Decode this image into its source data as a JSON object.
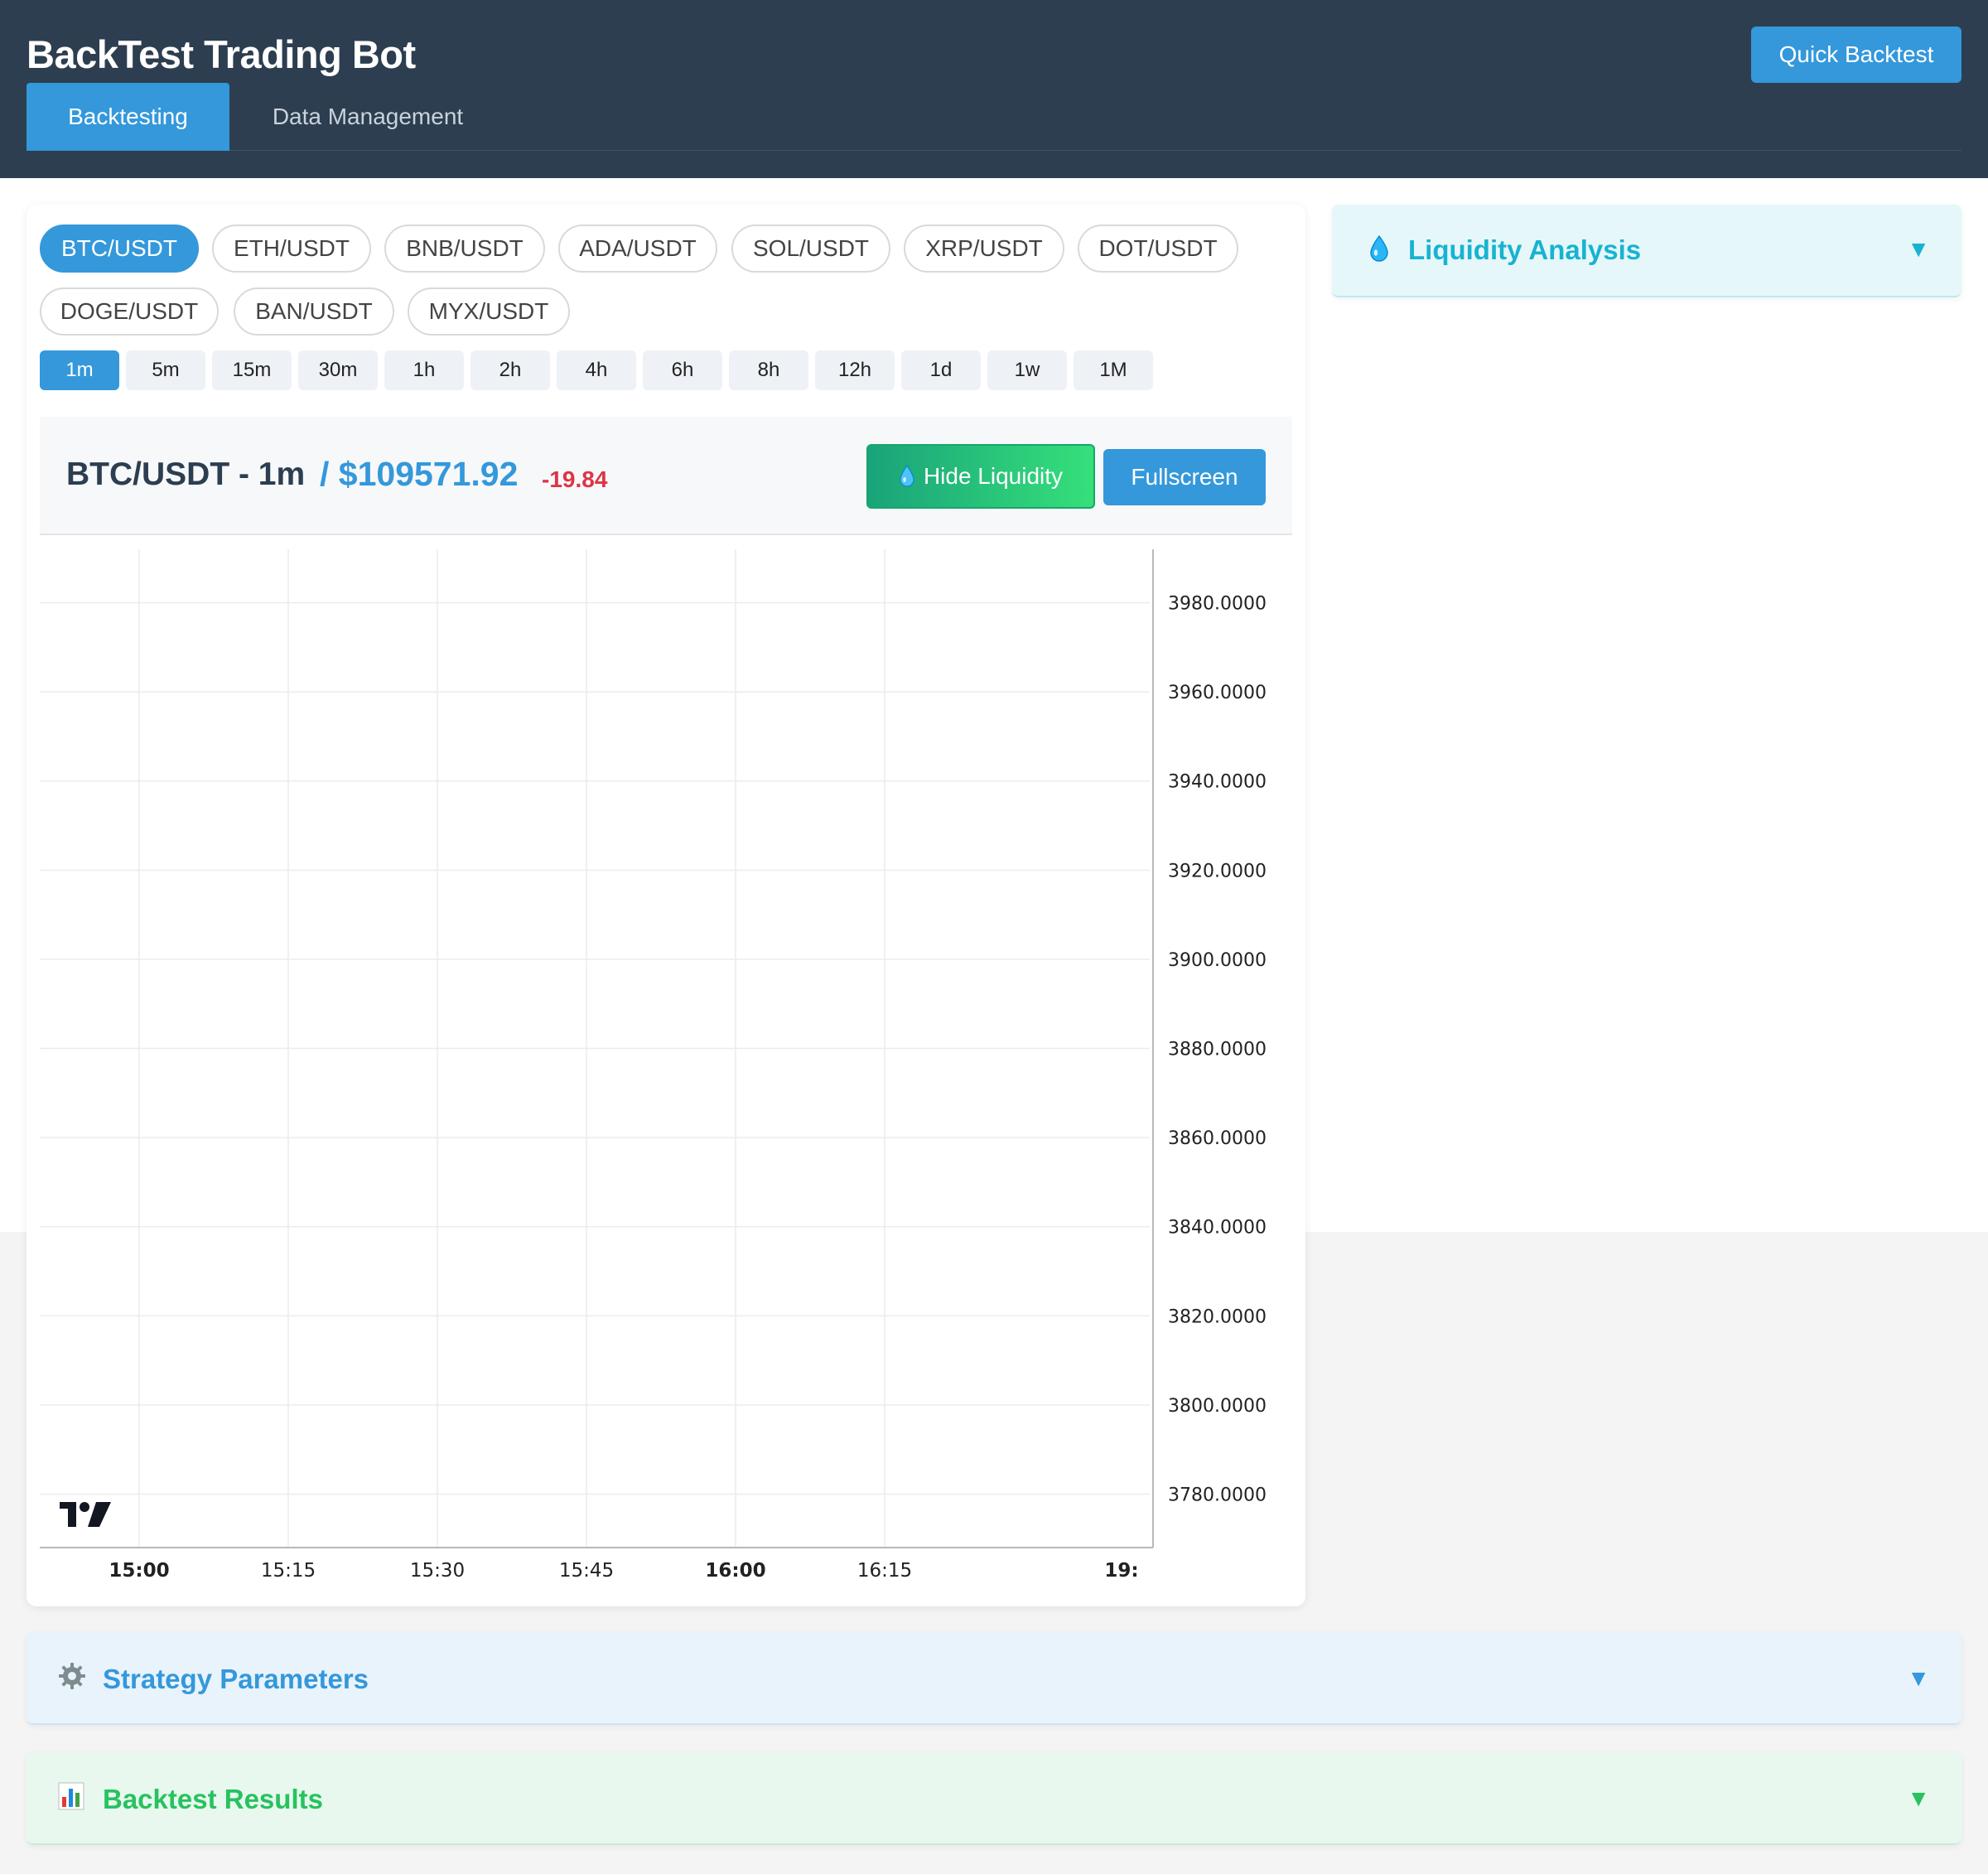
{
  "app": {
    "title": "BackTest Trading Bot",
    "quick_backtest_label": "Quick Backtest"
  },
  "nav": {
    "tabs": [
      {
        "label": "Backtesting",
        "active": true
      },
      {
        "label": "Data Management",
        "active": false
      }
    ]
  },
  "pairs": {
    "items": [
      "BTC/USDT",
      "ETH/USDT",
      "BNB/USDT",
      "ADA/USDT",
      "SOL/USDT",
      "XRP/USDT",
      "DOT/USDT",
      "DOGE/USDT",
      "BAN/USDT",
      "MYX/USDT"
    ],
    "selected": "BTC/USDT"
  },
  "timeframes": {
    "items": [
      "1m",
      "5m",
      "15m",
      "30m",
      "1h",
      "2h",
      "4h",
      "6h",
      "8h",
      "12h",
      "1d",
      "1w",
      "1M"
    ],
    "selected": "1m"
  },
  "chart_header": {
    "title": "BTC/USDT - 1m",
    "price": "/ $109571.92",
    "change": "-19.84",
    "hide_liquidity_label": "Hide Liquidity",
    "fullscreen_label": "Fullscreen"
  },
  "chart_data": {
    "type": "line",
    "series": [],
    "x_ticks": [
      {
        "label": "15:00",
        "bold": true
      },
      {
        "label": "15:15",
        "bold": false
      },
      {
        "label": "15:30",
        "bold": false
      },
      {
        "label": "15:45",
        "bold": false
      },
      {
        "label": "16:00",
        "bold": true
      },
      {
        "label": "16:15",
        "bold": false
      },
      {
        "label": "19:",
        "bold": true
      }
    ],
    "y_ticks": [
      "3980.0000",
      "3960.0000",
      "3940.0000",
      "3920.0000",
      "3900.0000",
      "3880.0000",
      "3860.0000",
      "3840.0000",
      "3820.0000",
      "3800.0000",
      "3780.0000"
    ],
    "ylim": [
      3768,
      3992
    ],
    "grid": true,
    "watermark": "TV"
  },
  "panels": {
    "liquidity": {
      "title": "Liquidity Analysis",
      "icon": "droplet-icon",
      "color": "#17b3d1"
    },
    "strategy": {
      "title": "Strategy Parameters",
      "icon": "gear-icon",
      "color": "#3498db"
    },
    "results": {
      "title": "Backtest Results",
      "icon": "bar-chart-icon",
      "color": "#27c25f"
    }
  },
  "colors": {
    "header_bg": "#2d3e50",
    "accent": "#3498db",
    "negative": "#dc3545"
  }
}
